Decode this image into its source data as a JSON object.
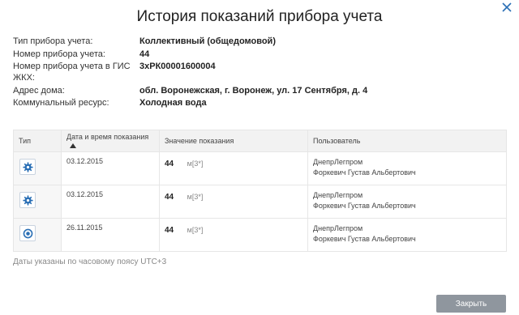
{
  "dialog": {
    "title": "История показаний прибора учета",
    "close_icon": "close-icon"
  },
  "info": [
    {
      "label": "Тип прибора учета:",
      "value": "Коллективный (общедомовой)"
    },
    {
      "label": "Номер прибора учета:",
      "value": "44"
    },
    {
      "label": "Номер прибора учета в ГИС ЖКХ:",
      "value": "3хРК00001600004"
    },
    {
      "label": "Адрес дома:",
      "value": "обл. Воронежская, г. Воронеж, ул. 17 Сентября, д. 4"
    },
    {
      "label": "Коммунальный ресурс:",
      "value": "Холодная вода"
    }
  ],
  "table": {
    "headers": {
      "type": "Тип",
      "date": "Дата и время показания",
      "value": "Значение показания",
      "user": "Пользователь"
    },
    "rows": [
      {
        "icon": "gear-icon",
        "date": "03.12.2015",
        "value": "44",
        "unit": "м[3*]",
        "org": "ДнепрЛегпром",
        "person": "Форкевич Густав Альбертович"
      },
      {
        "icon": "gear-icon",
        "date": "03.12.2015",
        "value": "44",
        "unit": "м[3*]",
        "org": "ДнепрЛегпром",
        "person": "Форкевич Густав Альбертович"
      },
      {
        "icon": "target-icon",
        "date": "26.11.2015",
        "value": "44",
        "unit": "м[3*]",
        "org": "ДнепрЛегпром",
        "person": "Форкевич Густав Альбертович"
      }
    ]
  },
  "footnote": "Даты указаны по часовому поясу UTC+3",
  "buttons": {
    "close_label": "Закрыть"
  },
  "colors": {
    "accent_blue": "#2a6fb5",
    "close_button_bg": "#8f969e"
  }
}
